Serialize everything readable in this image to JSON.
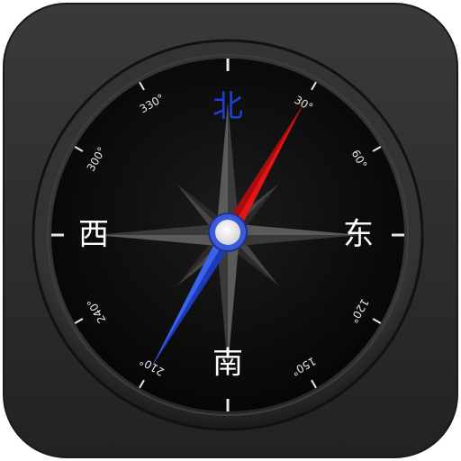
{
  "app": {
    "icon_name": "compass-icon"
  },
  "compass": {
    "cardinals": {
      "north": "北",
      "east": "东",
      "south": "南",
      "west": "西"
    },
    "degree_labels": [
      {
        "text": "30°",
        "bearing": 30
      },
      {
        "text": "60°",
        "bearing": 60
      },
      {
        "text": "120°",
        "bearing": 120
      },
      {
        "text": "150°",
        "bearing": 150
      },
      {
        "text": "210°",
        "bearing": 210
      },
      {
        "text": "240°",
        "bearing": 240
      },
      {
        "text": "300°",
        "bearing": 300
      },
      {
        "text": "330°",
        "bearing": 330
      }
    ],
    "needle_bearing": 30,
    "colors": {
      "north_label": "#1e3fd6",
      "cardinal_label": "#ffffff",
      "needle_north": "#e01010",
      "needle_south": "#2a52e8",
      "dial_face": "#0d0d0d",
      "bezel": "#2b2b2b",
      "tile": "#2e2e2e"
    }
  }
}
